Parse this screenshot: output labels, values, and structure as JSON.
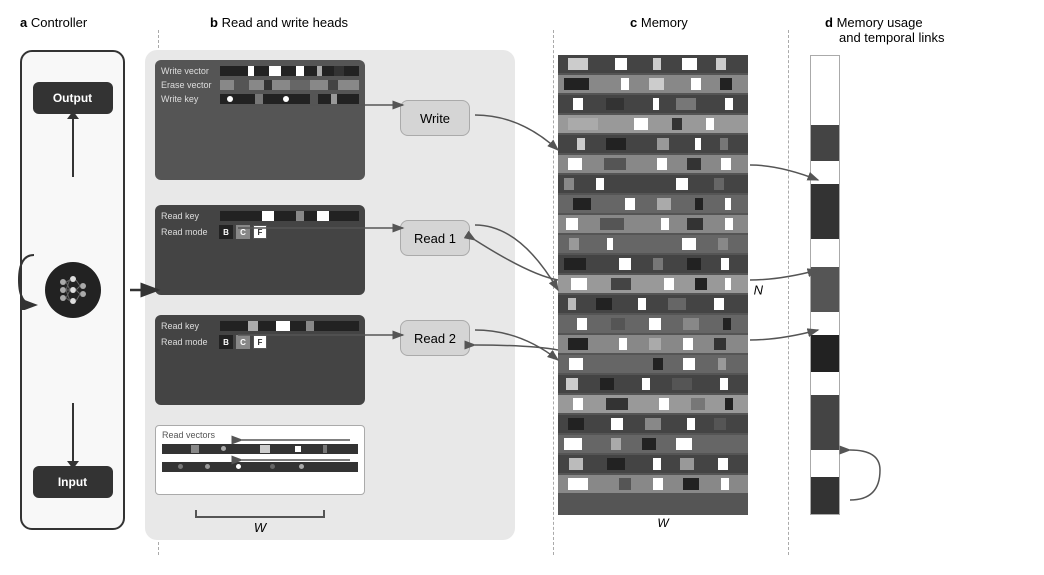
{
  "sections": {
    "a": {
      "label": "a",
      "title": "Controller"
    },
    "b": {
      "label": "b",
      "title": "Read and write heads"
    },
    "c": {
      "label": "c",
      "title": "Memory"
    },
    "d": {
      "label": "d",
      "title": "Memory usage",
      "subtitle": "and temporal links"
    }
  },
  "controller": {
    "output_label": "Output",
    "input_label": "Input"
  },
  "write_head": {
    "write_vector_label": "Write vector",
    "erase_vector_label": "Erase vector",
    "write_key_label": "Write key",
    "button": "Write"
  },
  "read_heads": [
    {
      "key_label": "Read key",
      "mode_label": "Read mode",
      "modes": [
        "B",
        "C",
        "F"
      ],
      "button": "Read 1"
    },
    {
      "key_label": "Read key",
      "mode_label": "Read mode",
      "modes": [
        "B",
        "C",
        "F"
      ],
      "button": "Read 2"
    }
  ],
  "read_vectors": {
    "label": "Read vectors"
  },
  "w_label": "W",
  "n_label": "N"
}
